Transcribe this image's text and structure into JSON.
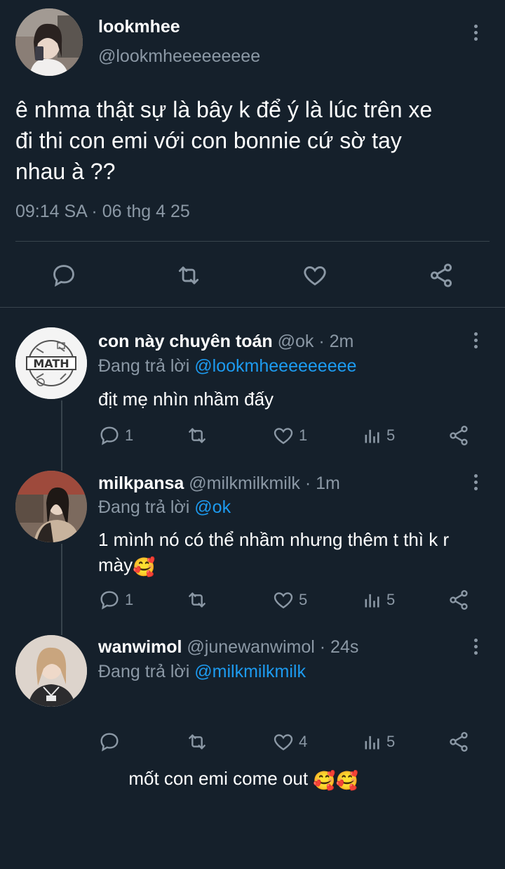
{
  "main_tweet": {
    "display_name": "lookmhee",
    "handle": "@lookmheeeeeeeee",
    "text_lines": [
      "ê nhma thật sự là bây k để ý là lúc trên xe",
      "đi thi con emi với con bonnie cứ sờ tay",
      "nhau à ??"
    ],
    "timestamp": "09:14 SA · 06 thg 4 25"
  },
  "replies": [
    {
      "display_name": "con này chuyên toán",
      "handle": "@ok",
      "time": "· 2m",
      "replying_prefix": "Đang trả lời",
      "replying_to": "@lookmheeeeeeeee",
      "text_lines": [
        "địt mẹ nhìn nhầm đấy"
      ],
      "reply_count": "1",
      "like_count": "1",
      "views": "5"
    },
    {
      "display_name": "milkpansa",
      "handle": "@milkmilkmilk",
      "time": "· 1m",
      "replying_prefix": "Đang trả lời",
      "replying_to": "@ok",
      "text_lines": [
        "1 mình nó có thể nhầm nhưng thêm t thì k r",
        "mày"
      ],
      "emoji": "🥰",
      "reply_count": "1",
      "like_count": "5",
      "views": "5"
    },
    {
      "display_name": "wanwimol",
      "handle": "@junewanwimol",
      "time": "· 24s",
      "replying_prefix": "Đang trả lời",
      "replying_to": "@milkmilkmilk",
      "text_lines": [
        "mốt con emi come out "
      ],
      "emoji": "🥰🥰",
      "reply_count": "",
      "like_count": "4",
      "views": "5"
    }
  ],
  "icons": {
    "reply": "reply-icon",
    "retweet": "retweet-icon",
    "like": "heart-icon",
    "share": "share-icon",
    "views": "views-icon",
    "menu": "more-options-icon"
  },
  "colors": {
    "background": "#15202b",
    "text": "#ffffff",
    "muted": "#8b98a5",
    "link": "#1d9bf0",
    "divider": "#38444d"
  }
}
